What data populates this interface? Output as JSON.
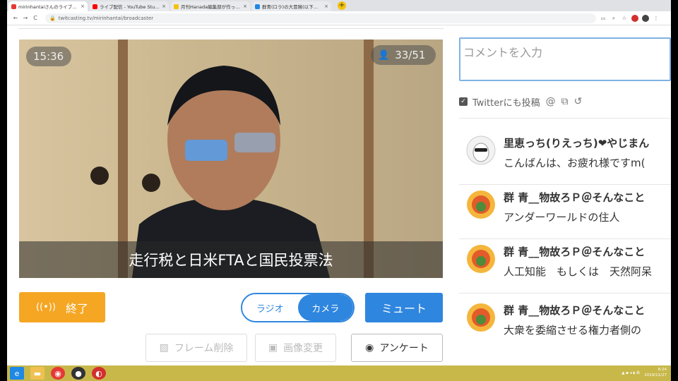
{
  "browser": {
    "tabs": [
      {
        "title": "mirinhantaiさんのライブ配信",
        "color": "#e53935",
        "active": true
      },
      {
        "title": "ライブ配信 - YouTube Studio",
        "color": "#ff0000",
        "active": false
      },
      {
        "title": "月刊Hanada編集部が作った入門",
        "color": "#f4c20d",
        "active": false
      },
      {
        "title": "群青(ロラ)の大冒険(以下、本編",
        "color": "#1e88e5",
        "active": false
      }
    ],
    "new_tab": "+",
    "url": "twitcasting.tv/mirinhantai/broadcaster",
    "back": "←",
    "forward": "→",
    "reload": "C",
    "lock": "🔒"
  },
  "video": {
    "time": "15:36",
    "viewers": "33/51",
    "caption": "走行税と日米FTAと国民投票法"
  },
  "controls": {
    "end_label": "終了",
    "end_icon": "((•))",
    "radio_label": "ラジオ",
    "camera_label": "カメラ",
    "mute_label": "ミュート",
    "frame_delete": "フレーム削除",
    "image_change": "画像変更",
    "survey": "アンケート"
  },
  "comment_box": {
    "placeholder": "コメントを入力",
    "twitter_label": "Twitterにも投稿",
    "at_icon": "@"
  },
  "comments": [
    {
      "name": "里恵っち(りえっち)❤やじまん",
      "text": "こんばんは、お疲れ様ですm("
    },
    {
      "name": "群 青__物故ろＰ＠そんなこと",
      "text": "アンダーワールドの住人"
    },
    {
      "name": "群 青__物故ろＰ＠そんなこと",
      "text": "人工知能　もしくは　天然阿呆"
    },
    {
      "name": "群 青__物故ろＰ＠そんなこと",
      "text": "大衆を委縮させる権力者側の"
    }
  ],
  "taskbar": {
    "time": "8:24",
    "date": "2019/11/27"
  },
  "colors": {
    "accent_blue": "#2e86de",
    "end_orange": "#f5a623",
    "taskbar": "#c8b84a"
  }
}
